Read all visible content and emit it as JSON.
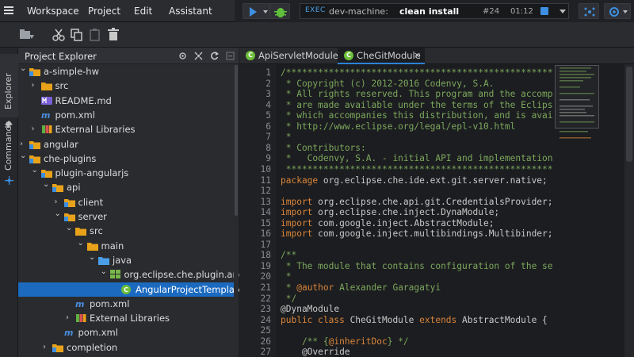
{
  "menubar": {
    "items": [
      "Workspace",
      "Project",
      "Edit",
      "Assistant"
    ]
  },
  "runbar": {
    "exec_label": "EXEC",
    "machine": "dev-machine:",
    "command": "clean install",
    "process_number": "#24",
    "elapsed": "01:12"
  },
  "explorer": {
    "title": "Project Explorer",
    "tree": [
      {
        "label": "a-simple-hw",
        "icon": "project-folder-icon",
        "depth": 0,
        "expanded": true
      },
      {
        "label": "src",
        "icon": "folder-icon",
        "depth": 1,
        "expanded": false
      },
      {
        "label": "README.md",
        "icon": "markdown-file-icon",
        "depth": 1
      },
      {
        "label": "pom.xml",
        "icon": "maven-file-icon",
        "depth": 1
      },
      {
        "label": "External Libraries",
        "icon": "libraries-icon",
        "depth": 1,
        "expanded": false
      },
      {
        "label": "angular",
        "icon": "project-folder-icon",
        "depth": 0,
        "expanded": false
      },
      {
        "label": "che-plugins",
        "icon": "project-folder-icon",
        "depth": 0,
        "expanded": true
      },
      {
        "label": "plugin-angularjs",
        "icon": "project-folder-icon",
        "depth": 1,
        "expanded": true
      },
      {
        "label": "api",
        "icon": "project-folder-icon",
        "depth": 2,
        "expanded": true
      },
      {
        "label": "client",
        "icon": "project-folder-icon",
        "depth": 3,
        "expanded": false
      },
      {
        "label": "server",
        "icon": "project-folder-icon",
        "depth": 3,
        "expanded": true
      },
      {
        "label": "src",
        "icon": "folder-icon",
        "depth": 4,
        "expanded": true
      },
      {
        "label": "main",
        "icon": "folder-icon",
        "depth": 5,
        "expanded": true
      },
      {
        "label": "java",
        "icon": "source-folder-icon",
        "depth": 6,
        "expanded": true
      },
      {
        "label": "org.eclipse.che.plugin.angula",
        "icon": "package-icon",
        "depth": 7,
        "expanded": true
      },
      {
        "label": "AngularProjectTemplateEx",
        "icon": "java-class-icon",
        "depth": 8,
        "selected": true
      },
      {
        "label": "pom.xml",
        "icon": "maven-file-icon",
        "depth": 4
      },
      {
        "label": "External Libraries",
        "icon": "libraries-icon",
        "depth": 4,
        "expanded": false
      },
      {
        "label": "pom.xml",
        "icon": "maven-file-icon",
        "depth": 3
      },
      {
        "label": "completion",
        "icon": "project-folder-icon",
        "depth": 2,
        "expanded": false
      }
    ]
  },
  "siderail": {
    "explorer_label": "Explorer",
    "commands_label": "Commands"
  },
  "editor": {
    "tabs": [
      {
        "label": "ApiServletModule",
        "active": false
      },
      {
        "label": "CheGitModule",
        "active": true
      }
    ],
    "close_glyph": "×",
    "lines": [
      {
        "n": "1",
        "parts": [
          {
            "t": "/*******************************************************************",
            "c": "com"
          }
        ]
      },
      {
        "n": "2",
        "parts": [
          {
            "t": " * Copyright (c) 2012-2016 Codenvy, S.A.",
            "c": "com"
          }
        ]
      },
      {
        "n": "3",
        "parts": [
          {
            "t": " * All rights reserved. This program and the accompanying",
            "c": "com"
          }
        ]
      },
      {
        "n": "4",
        "parts": [
          {
            "t": " * are made available under the terms of the Eclipse Public",
            "c": "com"
          }
        ]
      },
      {
        "n": "5",
        "parts": [
          {
            "t": " * which accompanies this distribution, and is available at",
            "c": "com"
          }
        ]
      },
      {
        "n": "6",
        "parts": [
          {
            "t": " * http://www.eclipse.org/legal/epl-v10.html",
            "c": "com"
          }
        ]
      },
      {
        "n": "7",
        "parts": [
          {
            "t": " *",
            "c": "com"
          }
        ]
      },
      {
        "n": "8",
        "parts": [
          {
            "t": " * Contributors:",
            "c": "com"
          }
        ]
      },
      {
        "n": "9",
        "parts": [
          {
            "t": " *   Codenvy, S.A. - initial API and implementation",
            "c": "com"
          }
        ]
      },
      {
        "n": "10",
        "parts": [
          {
            "t": " *******************************************************************",
            "c": "com"
          }
        ]
      },
      {
        "n": "11",
        "parts": [
          {
            "t": "package",
            "c": "kw"
          },
          {
            "t": " org.eclipse.che.ide.ext.git.server.native;",
            "c": ""
          }
        ]
      },
      {
        "n": "12",
        "parts": []
      },
      {
        "n": "13",
        "parts": [
          {
            "t": "import",
            "c": "kw"
          },
          {
            "t": " org.eclipse.che.api.git.CredentialsProvider;",
            "c": ""
          }
        ]
      },
      {
        "n": "14",
        "parts": [
          {
            "t": "import",
            "c": "kw"
          },
          {
            "t": " org.eclipse.che.inject.DynaModule;",
            "c": ""
          }
        ]
      },
      {
        "n": "15",
        "parts": [
          {
            "t": "import",
            "c": "kw"
          },
          {
            "t": " com.google.inject.AbstractModule;",
            "c": ""
          }
        ]
      },
      {
        "n": "16",
        "parts": [
          {
            "t": "import",
            "c": "kw"
          },
          {
            "t": " com.google.inject.multibindings.Multibinder;",
            "c": ""
          }
        ]
      },
      {
        "n": "17",
        "parts": []
      },
      {
        "n": "18",
        "parts": [
          {
            "t": "/**",
            "c": "com"
          }
        ]
      },
      {
        "n": "19",
        "parts": [
          {
            "t": " * The module that contains configuration of the server side",
            "c": "com"
          }
        ]
      },
      {
        "n": "20",
        "parts": [
          {
            "t": " *",
            "c": "com"
          }
        ]
      },
      {
        "n": "21",
        "parts": [
          {
            "t": " * ",
            "c": "com"
          },
          {
            "t": "@author",
            "c": "tag"
          },
          {
            "t": " Alexander Garagatyi",
            "c": "com"
          }
        ]
      },
      {
        "n": "22",
        "parts": [
          {
            "t": " */",
            "c": "com"
          }
        ]
      },
      {
        "n": "23",
        "parts": [
          {
            "t": "@DynaModule",
            "c": "ann"
          }
        ]
      },
      {
        "n": "24",
        "parts": [
          {
            "t": "public class",
            "c": "kw"
          },
          {
            "t": " CheGitModule ",
            "c": ""
          },
          {
            "t": "extends",
            "c": "kw"
          },
          {
            "t": " AbstractModule {",
            "c": ""
          }
        ]
      },
      {
        "n": "25",
        "parts": []
      },
      {
        "n": "26",
        "parts": [
          {
            "t": "    /** {",
            "c": "com"
          },
          {
            "t": "@inheritDoc",
            "c": "tag"
          },
          {
            "t": "} */",
            "c": "com"
          }
        ]
      },
      {
        "n": "27",
        "parts": [
          {
            "t": "    @Override",
            "c": "ann"
          }
        ]
      }
    ]
  },
  "colors": {
    "accent": "#2b82d9",
    "selection": "#1b6ac0",
    "comment": "#7ca85d",
    "keyword": "#d9853a"
  }
}
